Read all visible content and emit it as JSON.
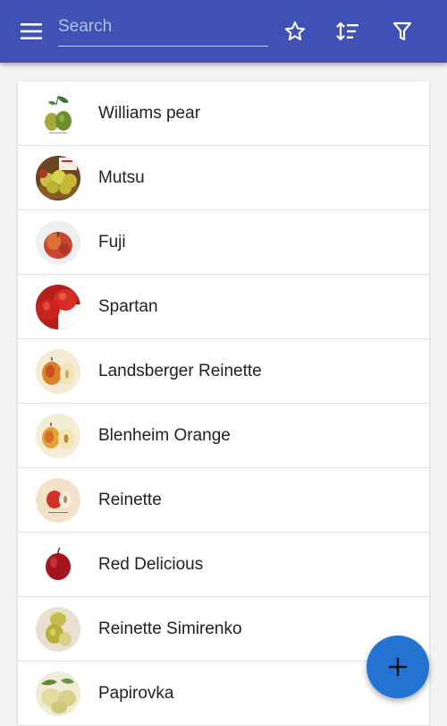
{
  "appbar": {
    "background": "#3f51b5",
    "menu_icon": "menu-icon",
    "search_placeholder": "Search",
    "search_value": "",
    "actions": [
      {
        "icon": "star-icon"
      },
      {
        "icon": "sort-icon"
      },
      {
        "icon": "filter-icon"
      }
    ]
  },
  "list": {
    "items": [
      {
        "label": "Williams pear",
        "icon": "pear-image"
      },
      {
        "label": "Mutsu",
        "icon": "apple-basket-image"
      },
      {
        "label": "Fuji",
        "icon": "apple-image"
      },
      {
        "label": "Spartan",
        "icon": "apple-image"
      },
      {
        "label": "Landsberger Reinette",
        "icon": "apple-illustration-image"
      },
      {
        "label": "Blenheim Orange",
        "icon": "apple-illustration-image"
      },
      {
        "label": "Reinette",
        "icon": "apple-illustration-image"
      },
      {
        "label": "Red Delicious",
        "icon": "apple-image"
      },
      {
        "label": "Reinette Simirenko",
        "icon": "apple-illustration-image"
      },
      {
        "label": "Papirovka",
        "icon": "apple-illustration-image"
      }
    ]
  },
  "fab": {
    "icon": "plus-icon",
    "color": "#2374d2"
  }
}
